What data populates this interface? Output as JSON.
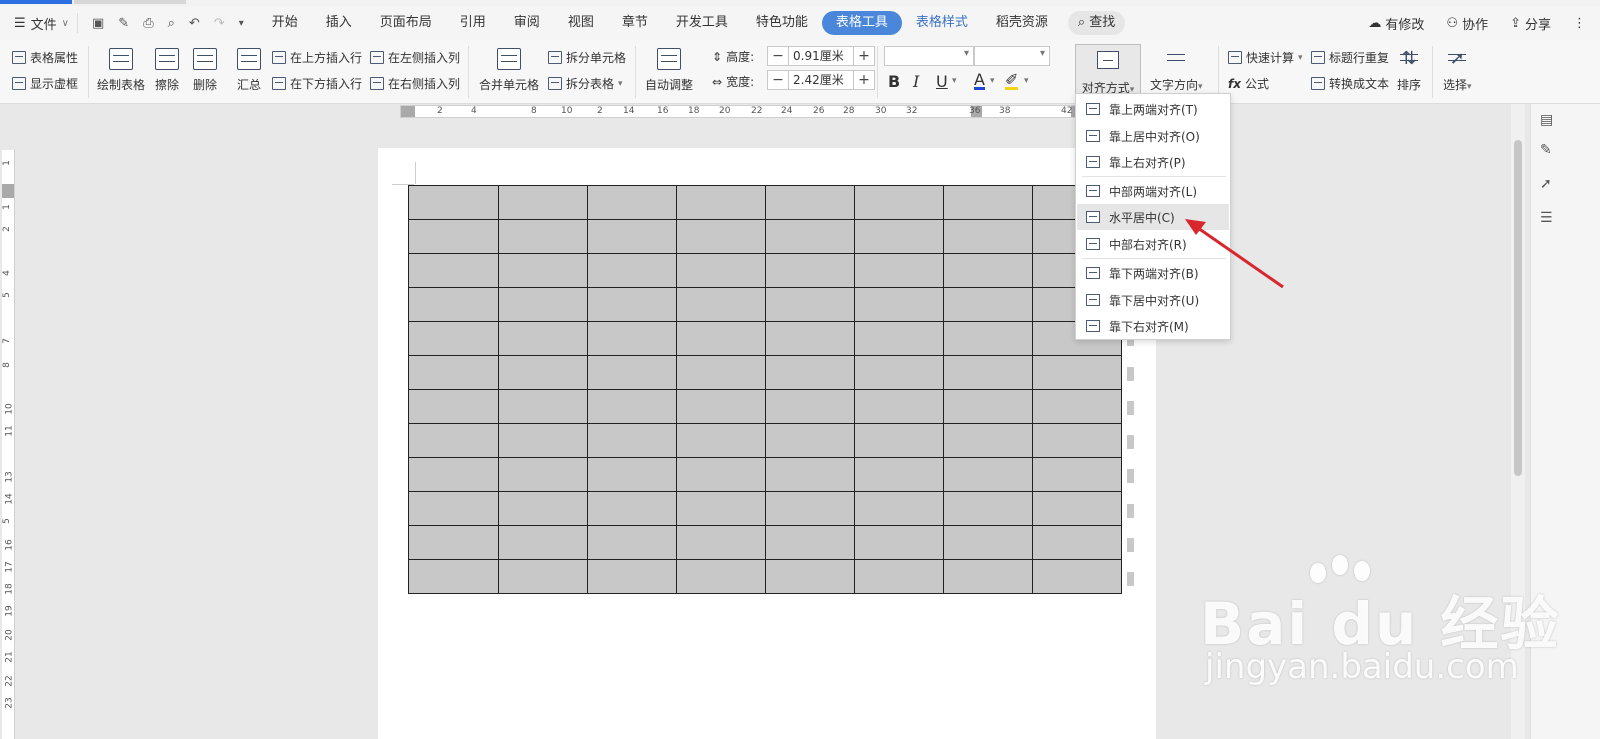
{
  "menubar": {
    "file": "文件",
    "tabs": [
      "开始",
      "插入",
      "页面布局",
      "引用",
      "审阅",
      "视图",
      "章节",
      "开发工具",
      "特色功能"
    ],
    "active_tab": "表格工具",
    "tab_style": "表格样式",
    "tab_resources": "稻壳资源",
    "search": "查找",
    "right": {
      "modified": "有修改",
      "collab": "协作",
      "share": "分享"
    }
  },
  "ribbon": {
    "table_props": "表格属性",
    "show_grid": "显示虚框",
    "draw_table": "绘制表格",
    "erase": "擦除",
    "delete": "删除",
    "summary": "汇总",
    "insert_row_above": "在上方插入行",
    "insert_row_below": "在下方插入行",
    "insert_col_left": "在左侧插入列",
    "insert_col_right": "在右侧插入列",
    "merge_cells": "合并单元格",
    "split_cells": "拆分单元格",
    "split_table": "拆分表格",
    "auto_fit": "自动调整",
    "height_label": "高度:",
    "height_value": "0.91厘米",
    "width_label": "宽度:",
    "width_value": "2.42厘米",
    "align": "对齐方式",
    "text_direction": "文字方向",
    "quick_calc": "快速计算",
    "repeat_header": "标题行重复",
    "formula": "公式",
    "to_text": "转换成文本",
    "sort": "排序",
    "select": "选择"
  },
  "dropdown": {
    "items": [
      "靠上两端对齐(T)",
      "靠上居中对齐(O)",
      "靠上右对齐(P)",
      "中部两端对齐(L)",
      "水平居中(C)",
      "中部右对齐(R)",
      "靠下两端对齐(B)",
      "靠下居中对齐(U)",
      "靠下右对齐(M)"
    ],
    "highlighted": "水平居中(C)"
  },
  "ruler": {
    "h_ticks": [
      "2",
      "4",
      "8",
      "10",
      "2",
      "14",
      "16",
      "18",
      "20",
      "22",
      "24",
      "26",
      "28",
      "30",
      "32",
      "36",
      "38",
      "42"
    ],
    "v_ticks": [
      "1",
      "1",
      "2",
      "4",
      "5",
      "7",
      "8",
      "10",
      "11",
      "13",
      "14",
      "5",
      "16",
      "17",
      "18",
      "19",
      "20",
      "21",
      "22",
      "23"
    ]
  },
  "table": {
    "rows": 12,
    "cols": 8
  },
  "watermark": {
    "logo": "Bai du 经验",
    "url": "jingyan.baidu.com"
  },
  "colors": {
    "accent": "#4a86d9",
    "cell_fill": "#c8c8c8",
    "arrow": "#d9262c"
  }
}
